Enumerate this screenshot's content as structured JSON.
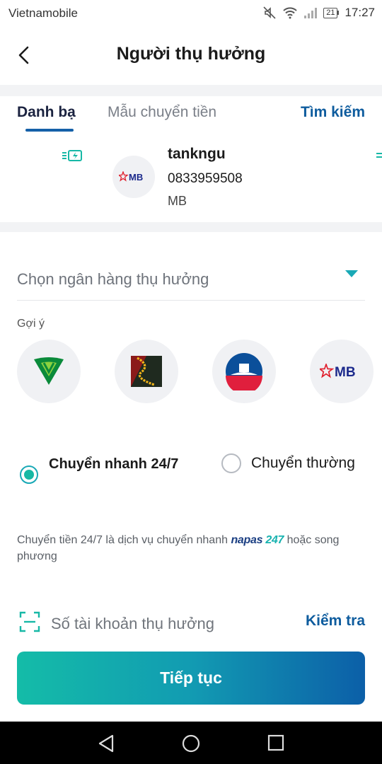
{
  "status_bar": {
    "carrier": "Vietnamobile",
    "battery": "21",
    "time": "17:27"
  },
  "header": {
    "title": "Người thụ hưởng"
  },
  "tabs": {
    "contacts": "Danh bạ",
    "templates": "Mẫu chuyển tiền",
    "search": "Tìm kiếm"
  },
  "contact": {
    "name": "tankngu",
    "account": "0833959508",
    "bank": "MB"
  },
  "bank_select": {
    "placeholder": "Chọn ngân hàng thụ hưởng"
  },
  "suggest": {
    "label": "Gợi ý",
    "banks": [
      "vietcombank-logo",
      "techcombank-logo",
      "vietinbank-logo",
      "mb-logo"
    ],
    "mb_text": "MB"
  },
  "transfer_type": {
    "fast": "Chuyển nhanh 24/7",
    "normal": "Chuyển thường",
    "selected": "fast"
  },
  "note": {
    "prefix": "Chuyển tiền 24/7 là dịch vụ chuyển nhanh",
    "brand_a": "napas",
    "brand_b": "247",
    "suffix": "hoặc song phương"
  },
  "account_input": {
    "placeholder": "Số tài khoản thụ hưởng",
    "check": "Kiểm tra"
  },
  "continue_button": "Tiếp tục",
  "colors": {
    "teal": "#16b8a4",
    "blue": "#0e5c9e",
    "gradient_end": "#0c5fa8"
  }
}
